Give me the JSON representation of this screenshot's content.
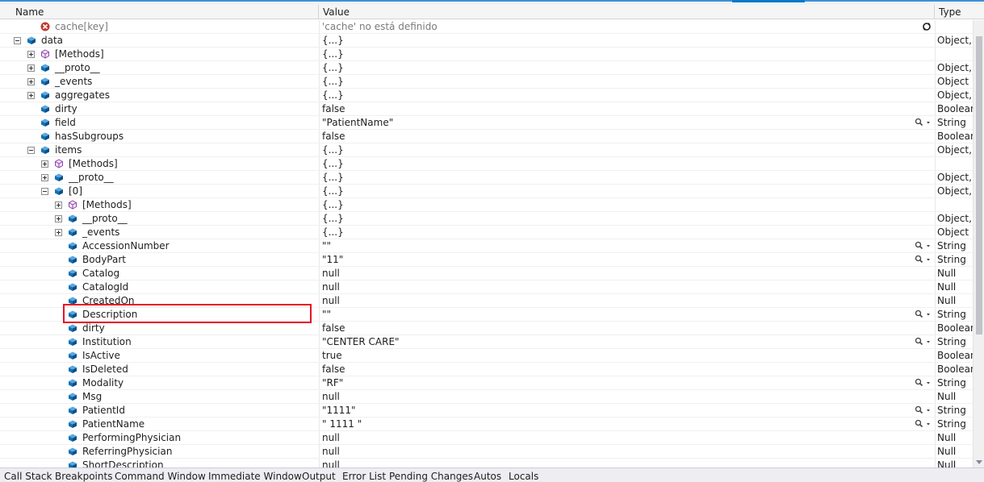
{
  "columns": {
    "name": "Name",
    "value": "Value",
    "type": "Type"
  },
  "colors": {
    "accent": "#007acc",
    "highlight": "#e81123",
    "cube_icon": "#1170b4",
    "methods_icon": "#8e44ad",
    "error_icon": "#c0392b"
  },
  "rows": [
    {
      "name": "cache[key]",
      "value": "'cache' no está definido",
      "type": "",
      "level": 1,
      "expander": "none",
      "icon": "error-icon",
      "refresh": true
    },
    {
      "name": "data",
      "value": "{...}",
      "type": "Object, (",
      "level": 0,
      "expander": "minus",
      "icon": "property-icon"
    },
    {
      "name": "[Methods]",
      "value": "{...}",
      "type": "",
      "level": 1,
      "expander": "plus",
      "icon": "methods-icon"
    },
    {
      "name": "__proto__",
      "value": "{...}",
      "type": "Object, (",
      "level": 1,
      "expander": "plus",
      "icon": "property-icon"
    },
    {
      "name": "_events",
      "value": "{...}",
      "type": "Object",
      "level": 1,
      "expander": "plus",
      "icon": "property-icon"
    },
    {
      "name": "aggregates",
      "value": "{...}",
      "type": "Object, (",
      "level": 1,
      "expander": "plus",
      "icon": "property-icon"
    },
    {
      "name": "dirty",
      "value": "false",
      "type": "Boolean",
      "level": 1,
      "expander": "none",
      "icon": "property-icon"
    },
    {
      "name": "field",
      "value": "\"PatientName\"",
      "type": "String",
      "level": 1,
      "expander": "none",
      "icon": "property-icon",
      "magnifier": true
    },
    {
      "name": "hasSubgroups",
      "value": "false",
      "type": "Boolean",
      "level": 1,
      "expander": "none",
      "icon": "property-icon"
    },
    {
      "name": "items",
      "value": "{...}",
      "type": "Object, (",
      "level": 1,
      "expander": "minus",
      "icon": "property-icon"
    },
    {
      "name": "[Methods]",
      "value": "{...}",
      "type": "",
      "level": 2,
      "expander": "plus",
      "icon": "methods-icon"
    },
    {
      "name": "__proto__",
      "value": "{...}",
      "type": "Object, (",
      "level": 2,
      "expander": "plus",
      "icon": "property-icon"
    },
    {
      "name": "[0]",
      "value": "{...}",
      "type": "Object, (",
      "level": 2,
      "expander": "minus",
      "icon": "property-icon"
    },
    {
      "name": "[Methods]",
      "value": "{...}",
      "type": "",
      "level": 3,
      "expander": "plus",
      "icon": "methods-icon"
    },
    {
      "name": "__proto__",
      "value": "{...}",
      "type": "Object, (",
      "level": 3,
      "expander": "plus",
      "icon": "property-icon"
    },
    {
      "name": "_events",
      "value": "{...}",
      "type": "Object",
      "level": 3,
      "expander": "plus",
      "icon": "property-icon"
    },
    {
      "name": "AccessionNumber",
      "value": "\"\"",
      "type": "String",
      "level": 3,
      "expander": "none",
      "icon": "property-icon",
      "magnifier": true
    },
    {
      "name": "BodyPart",
      "value": "\"11\"",
      "type": "String",
      "level": 3,
      "expander": "none",
      "icon": "property-icon",
      "magnifier": true
    },
    {
      "name": "Catalog",
      "value": "null",
      "type": "Null",
      "level": 3,
      "expander": "none",
      "icon": "property-icon"
    },
    {
      "name": "CatalogId",
      "value": "null",
      "type": "Null",
      "level": 3,
      "expander": "none",
      "icon": "property-icon"
    },
    {
      "name": "CreatedOn",
      "value": "null",
      "type": "Null",
      "level": 3,
      "expander": "none",
      "icon": "property-icon"
    },
    {
      "name": "Description",
      "value": "\"\"",
      "type": "String",
      "level": 3,
      "expander": "none",
      "icon": "property-icon",
      "magnifier": true
    },
    {
      "name": "dirty",
      "value": "false",
      "type": "Boolean",
      "level": 3,
      "expander": "none",
      "icon": "property-icon"
    },
    {
      "name": "Institution",
      "value": "\"CENTER CARE\"",
      "type": "String",
      "level": 3,
      "expander": "none",
      "icon": "property-icon",
      "magnifier": true
    },
    {
      "name": "IsActive",
      "value": "true",
      "type": "Boolean",
      "level": 3,
      "expander": "none",
      "icon": "property-icon"
    },
    {
      "name": "IsDeleted",
      "value": "false",
      "type": "Boolean",
      "level": 3,
      "expander": "none",
      "icon": "property-icon"
    },
    {
      "name": "Modality",
      "value": "\"RF\"",
      "type": "String",
      "level": 3,
      "expander": "none",
      "icon": "property-icon",
      "magnifier": true
    },
    {
      "name": "Msg",
      "value": "null",
      "type": "Null",
      "level": 3,
      "expander": "none",
      "icon": "property-icon"
    },
    {
      "name": "PatientId",
      "value": "\"1111\"",
      "type": "String",
      "level": 3,
      "expander": "none",
      "icon": "property-icon",
      "magnifier": true
    },
    {
      "name": "PatientName",
      "value": "\" 1111 \"",
      "type": "String",
      "level": 3,
      "expander": "none",
      "icon": "property-icon",
      "magnifier": true
    },
    {
      "name": "PerformingPhysician",
      "value": "null",
      "type": "Null",
      "level": 3,
      "expander": "none",
      "icon": "property-icon"
    },
    {
      "name": "ReferringPhysician",
      "value": "null",
      "type": "Null",
      "level": 3,
      "expander": "none",
      "icon": "property-icon"
    },
    {
      "name": "ShortDescription",
      "value": "null",
      "type": "Null",
      "level": 3,
      "expander": "none",
      "icon": "property-icon"
    }
  ],
  "bottom_tabs": [
    "Call Stack",
    "Breakpoints",
    "Command Window",
    "Immediate Window",
    "Output",
    "Error List",
    "Pending Changes",
    "Autos",
    "Locals"
  ]
}
